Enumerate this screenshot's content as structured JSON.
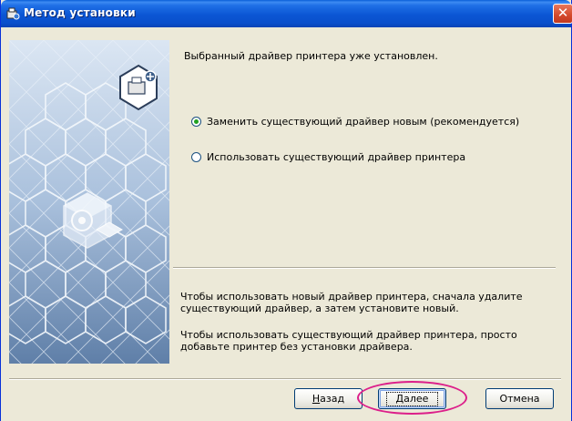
{
  "window": {
    "title": "Метод установки",
    "title_icon": "installer-icon",
    "close_glyph": "✕",
    "titlebar_color": "#0a56d4",
    "body_color": "#ece9d8"
  },
  "content": {
    "heading": "Выбранный драйвер принтера уже установлен.",
    "options": [
      {
        "label": "Заменить существующий драйвер новым (рекомендуется)",
        "selected": true
      },
      {
        "label": "Использовать существующий драйвер принтера",
        "selected": false
      }
    ],
    "info_1": "Чтобы использовать новый драйвер принтера, сначала удалите существующий драйвер, а затем установите новый.",
    "info_2": "Чтобы использовать существующий драйвер принтера, просто добавьте принтер без установки драйвера."
  },
  "buttons": {
    "back": {
      "accel": "Н",
      "rest": "азад"
    },
    "next": {
      "accel": "Д",
      "rest": "алее"
    },
    "cancel": "Отмена"
  },
  "highlight_color": "#dc1f8a"
}
